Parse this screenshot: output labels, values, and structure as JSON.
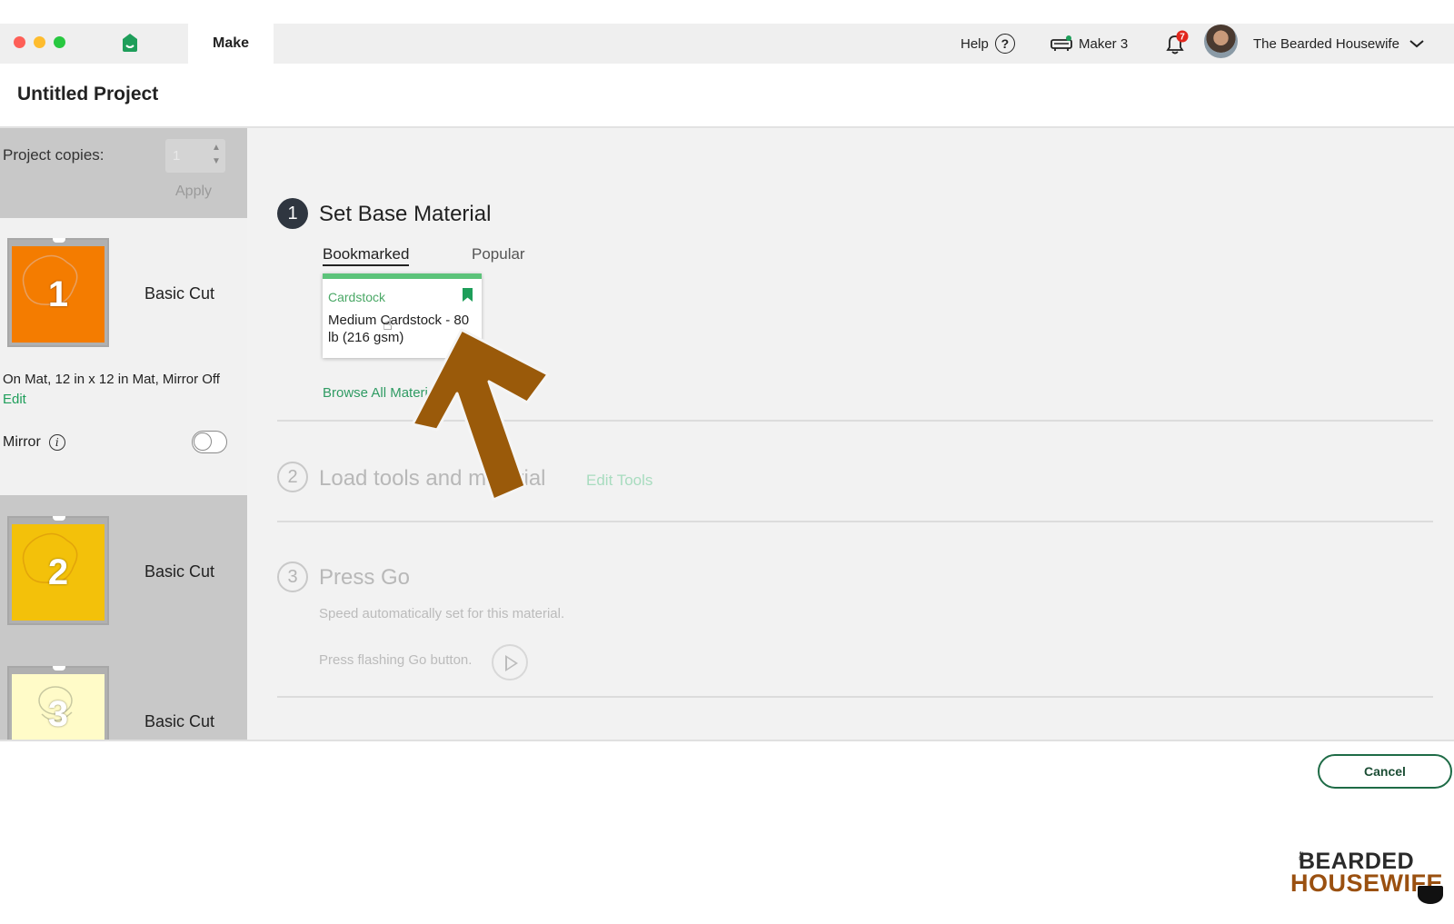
{
  "topbar": {
    "tab_make": "Make",
    "help_label": "Help",
    "help_glyph": "?",
    "machine_label": "Maker 3",
    "notification_count": "7",
    "user_name": "The Bearded Housewife"
  },
  "header": {
    "title": "Untitled Project"
  },
  "sidebar": {
    "copies_label": "Project copies:",
    "copies_value": "1",
    "apply_label": "Apply",
    "mats": [
      {
        "number": "1",
        "label": "Basic Cut",
        "color": "#f47c00"
      },
      {
        "number": "2",
        "label": "Basic Cut",
        "color": "#f3c10a"
      },
      {
        "number": "3",
        "label": "Basic Cut",
        "color": "#fffbc8"
      }
    ],
    "mat_info": "On Mat, 12 in x 12 in Mat, Mirror Off",
    "edit_label": "Edit",
    "mirror_label": "Mirror",
    "mirror_on": false
  },
  "steps": {
    "step1": {
      "number": "1",
      "title": "Set Base Material",
      "tabs": [
        "Bookmarked",
        "Popular"
      ],
      "card": {
        "category": "Cardstock",
        "name": "Medium Cardstock - 80 lb (216 gsm)"
      },
      "browse_label": "Browse All Materials"
    },
    "step2": {
      "number": "2",
      "title": "Load tools and material",
      "edit_tools_label": "Edit Tools"
    },
    "step3": {
      "number": "3",
      "title": "Press Go",
      "speed_text": "Speed automatically set for this material.",
      "go_text": "Press flashing Go button."
    }
  },
  "footer": {
    "cancel_label": "Cancel"
  },
  "watermark": {
    "the": "the",
    "line1": "BEARDED",
    "line2": "HOUSEWIFE"
  },
  "colors": {
    "accent_green": "#1e9e5a",
    "arrow_brown": "#9a5a0a",
    "dark": "#2f3640"
  }
}
